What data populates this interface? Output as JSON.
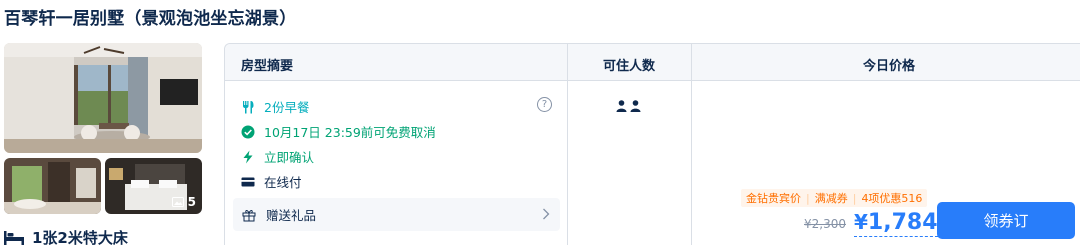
{
  "room": {
    "title": "百琴轩一居别墅（景观泡池坐忘湖景）",
    "photo_count": "5",
    "bed": "1张2米特大床"
  },
  "table": {
    "headers": {
      "summary": "房型摘要",
      "occupancy": "可住人数",
      "price": "今日价格"
    },
    "features": [
      {
        "icon": "utensils-icon",
        "text": "2份早餐",
        "color": "#06aebd"
      },
      {
        "icon": "check-circle-icon",
        "text": "10月17日 23:59前可免费取消",
        "color": "#00a374"
      },
      {
        "icon": "lightning-icon",
        "text": "立即确认",
        "color": "#00a374"
      },
      {
        "icon": "card-icon",
        "text": "在线付",
        "color": "#0f294d"
      }
    ],
    "gift": {
      "label": "赠送礼品"
    },
    "occupancy_icons": [
      "person-icon",
      "person-icon"
    ],
    "price": {
      "tags": [
        "金钻贵宾价",
        "满减券",
        "4项优惠516"
      ],
      "original": "¥2,300",
      "currency": "¥",
      "current": "1,784",
      "button": "领券订"
    }
  },
  "colors": {
    "brand_blue": "#287dfa",
    "text_dark": "#0f294d",
    "tag_orange": "#ff6f00",
    "border": "#dadfe6"
  }
}
